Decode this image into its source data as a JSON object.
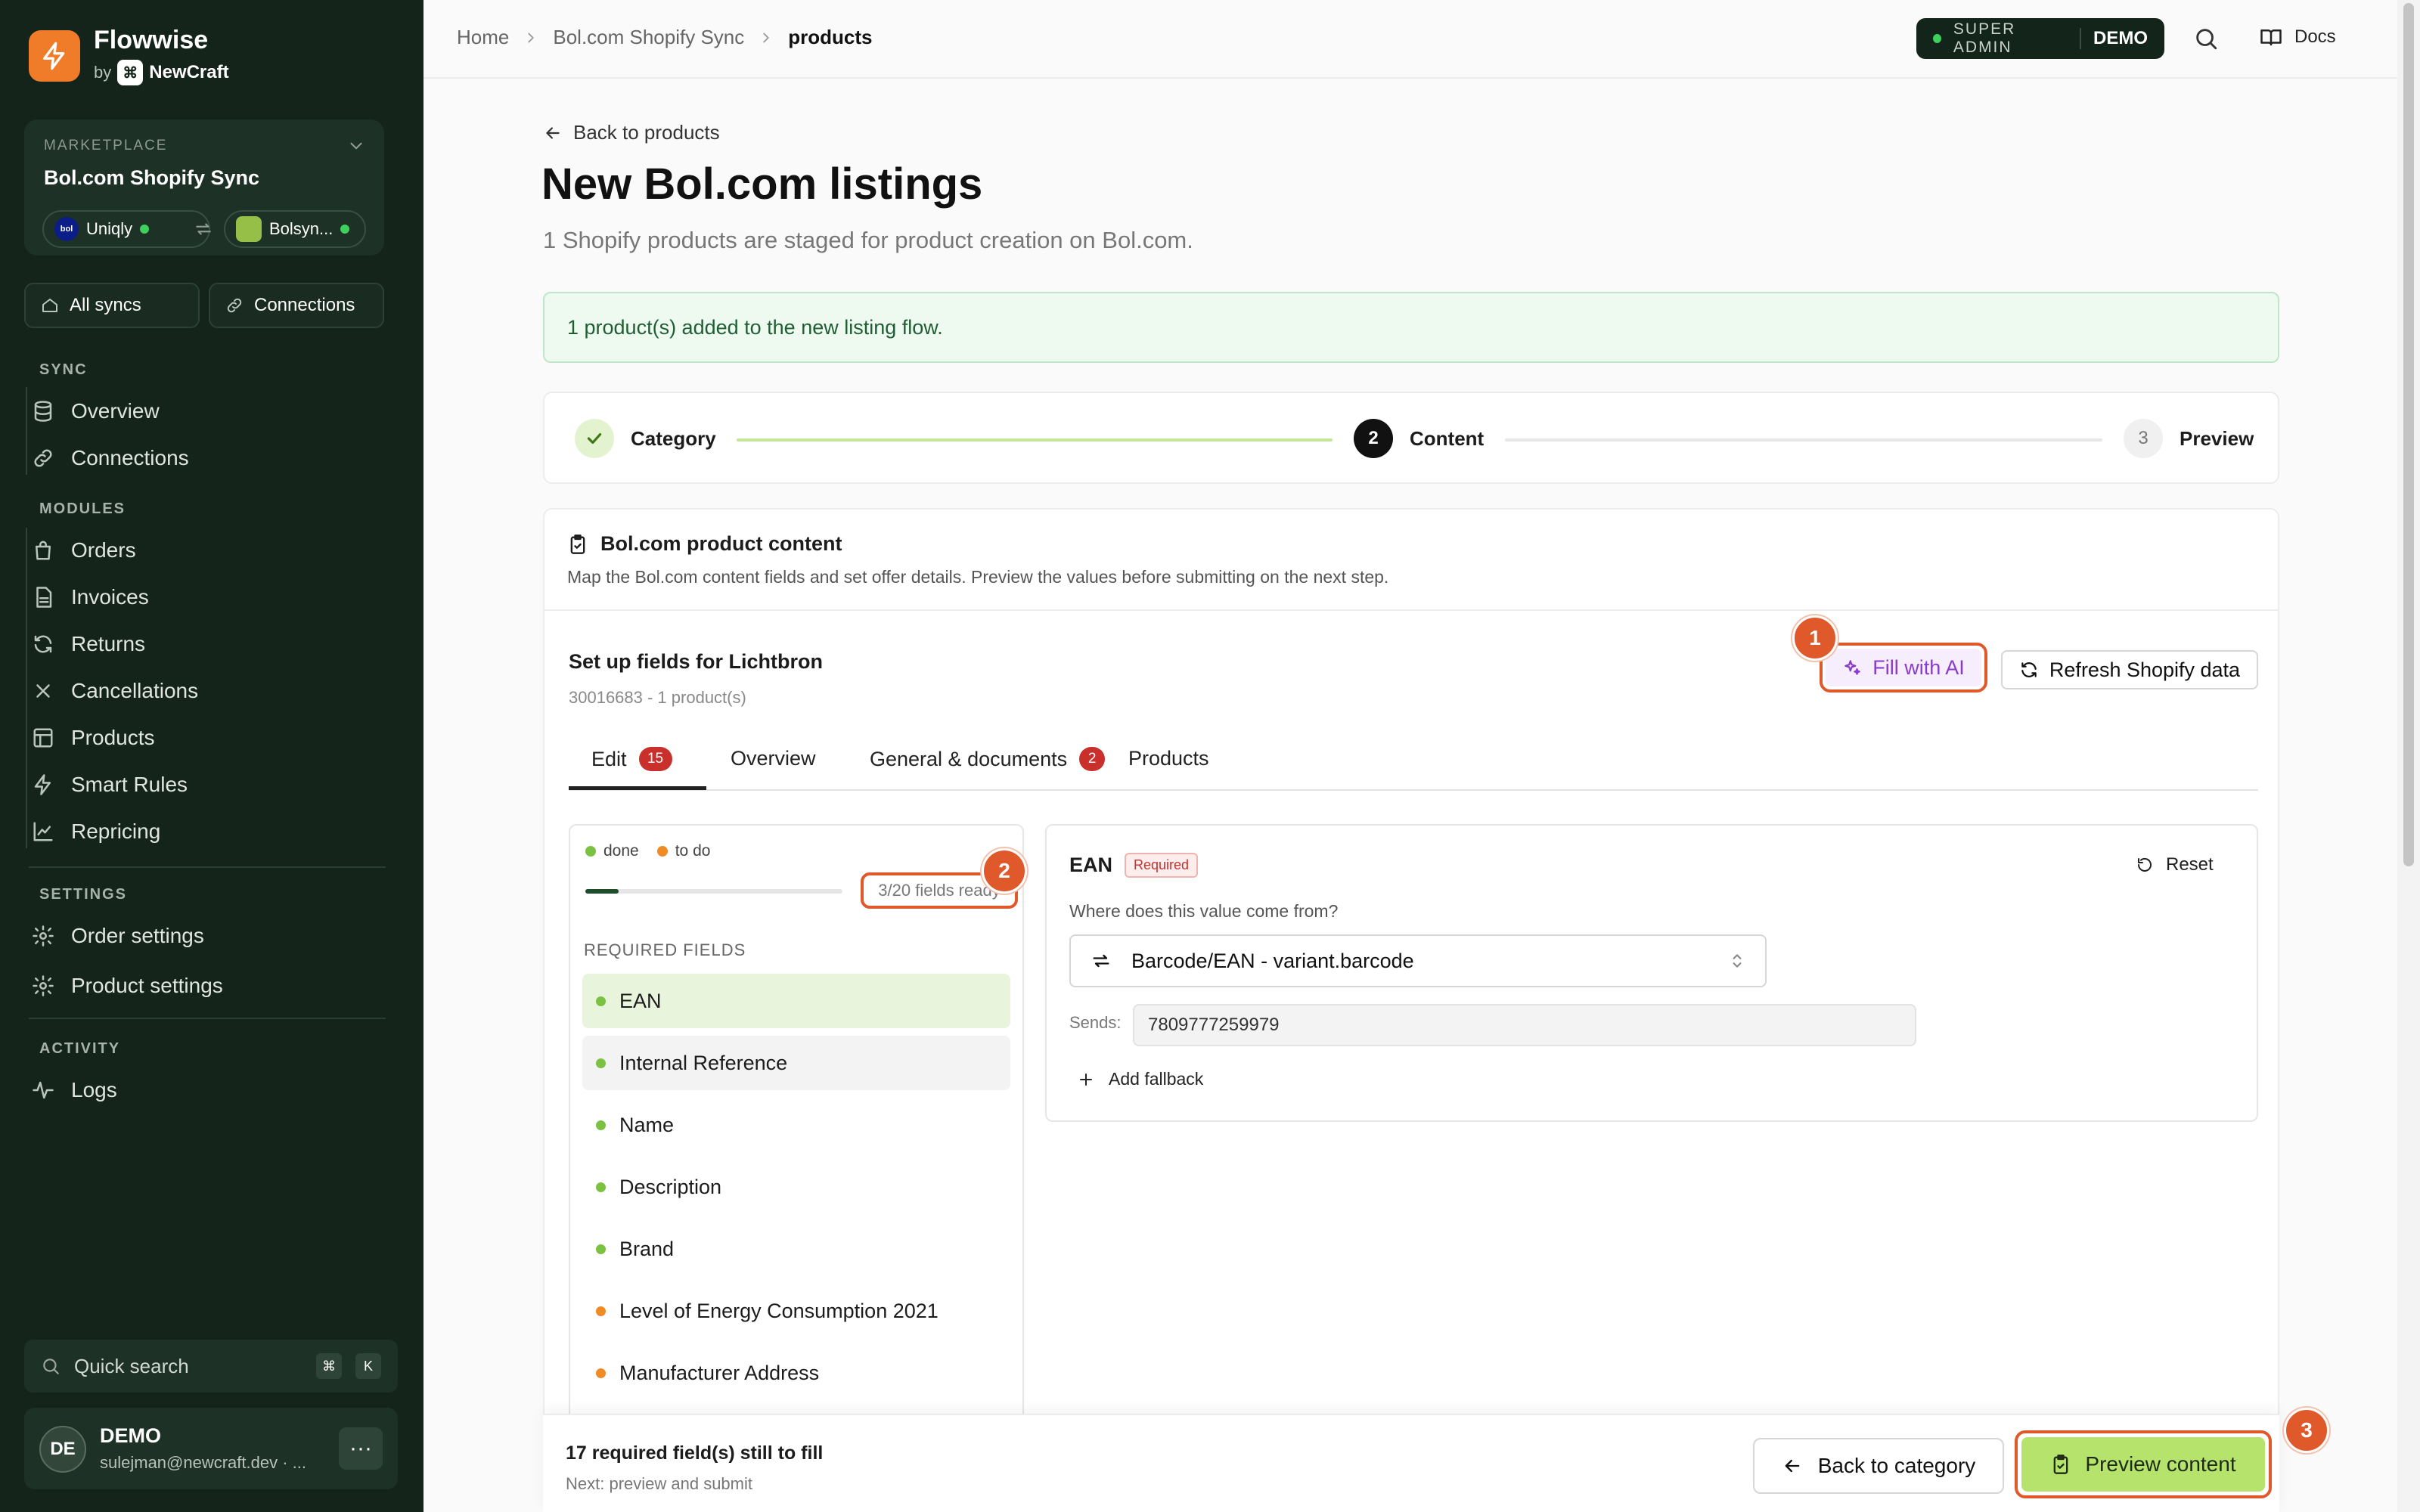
{
  "sidebar": {
    "brand": {
      "name": "Flowwise",
      "by": "by",
      "company": "NewCraft",
      "company_mark": "⌘"
    },
    "marketplace": {
      "label": "MARKETPLACE",
      "name": "Bol.com Shopify Sync",
      "source_mark": "bol",
      "source": "Uniqly",
      "target": "Bolsyn..."
    },
    "quick": {
      "all_syncs": "All syncs",
      "connections": "Connections"
    },
    "sections": {
      "sync": "SYNC",
      "modules": "MODULES",
      "settings": "SETTINGS",
      "activity": "ACTIVITY"
    },
    "sync_items": [
      "Overview",
      "Connections"
    ],
    "module_items": [
      "Orders",
      "Invoices",
      "Returns",
      "Cancellations",
      "Products",
      "Smart Rules",
      "Repricing"
    ],
    "settings_items": [
      "Order settings",
      "Product settings"
    ],
    "activity_items": [
      "Logs"
    ],
    "quick_search": {
      "label": "Quick search",
      "key1": "⌘",
      "key2": "K"
    },
    "user": {
      "initials": "DE",
      "name": "DEMO",
      "email": "sulejman@newcraft.dev · ...",
      "more": "···"
    }
  },
  "topbar": {
    "breadcrumb": [
      "Home",
      "Bol.com Shopify Sync",
      "products"
    ],
    "role": "SUPER ADMIN",
    "env": "DEMO",
    "docs": "Docs"
  },
  "page": {
    "back": "Back to products",
    "title": "New Bol.com listings",
    "subtitle": "1 Shopify products are staged for product creation on Bol.com.",
    "alert": "1 product(s) added to the new listing flow."
  },
  "steps": [
    {
      "label": "Category",
      "number": "",
      "state": "done"
    },
    {
      "label": "Content",
      "number": "2",
      "state": "active"
    },
    {
      "label": "Preview",
      "number": "3",
      "state": "todo"
    }
  ],
  "content_card": {
    "title": "Bol.com product content",
    "description": "Map the Bol.com content fields and set offer details. Preview the values before submitting on the next step.",
    "setup_title": "Set up fields for Lichtbron",
    "setup_sub": "30016683 - 1 product(s)",
    "fill_ai": "Fill with AI",
    "refresh": "Refresh Shopify data",
    "badges": [
      "1",
      "2",
      "3"
    ],
    "tabs": [
      {
        "label": "Edit",
        "count": "15"
      },
      {
        "label": "Overview",
        "count": ""
      },
      {
        "label": "General & documents",
        "count": "2"
      },
      {
        "label": "Products",
        "count": ""
      }
    ]
  },
  "fields_panel": {
    "legend_done": "done",
    "legend_todo": "to do",
    "ready_text": "3/20 fields ready",
    "progress_fraction": 0.13,
    "required_label": "REQUIRED FIELDS",
    "fields": [
      {
        "name": "EAN",
        "state": "done"
      },
      {
        "name": "Internal Reference",
        "state": "done"
      },
      {
        "name": "Name",
        "state": "done"
      },
      {
        "name": "Description",
        "state": "done"
      },
      {
        "name": "Brand",
        "state": "done"
      },
      {
        "name": "Level of Energy Consumption 2021",
        "state": "todo"
      },
      {
        "name": "Manufacturer Address",
        "state": "todo"
      }
    ]
  },
  "field_editor": {
    "field": "EAN",
    "required": "Required",
    "reset": "Reset",
    "source_question": "Where does this value come from?",
    "source_value": "Barcode/EAN - variant.barcode",
    "sends_label": "Sends:",
    "sends_value": "7809777259979",
    "add_fallback": "Add fallback"
  },
  "footer": {
    "title": "17 required field(s) still to fill",
    "subtitle": "Next: preview and submit",
    "back": "Back to category",
    "preview": "Preview content"
  },
  "colors": {
    "accent_orange": "#e0592a",
    "done_green": "#7cc242",
    "todo_orange": "#f08a24",
    "sidebar_bg": "#14241b",
    "cta_green": "#b6e36b"
  }
}
